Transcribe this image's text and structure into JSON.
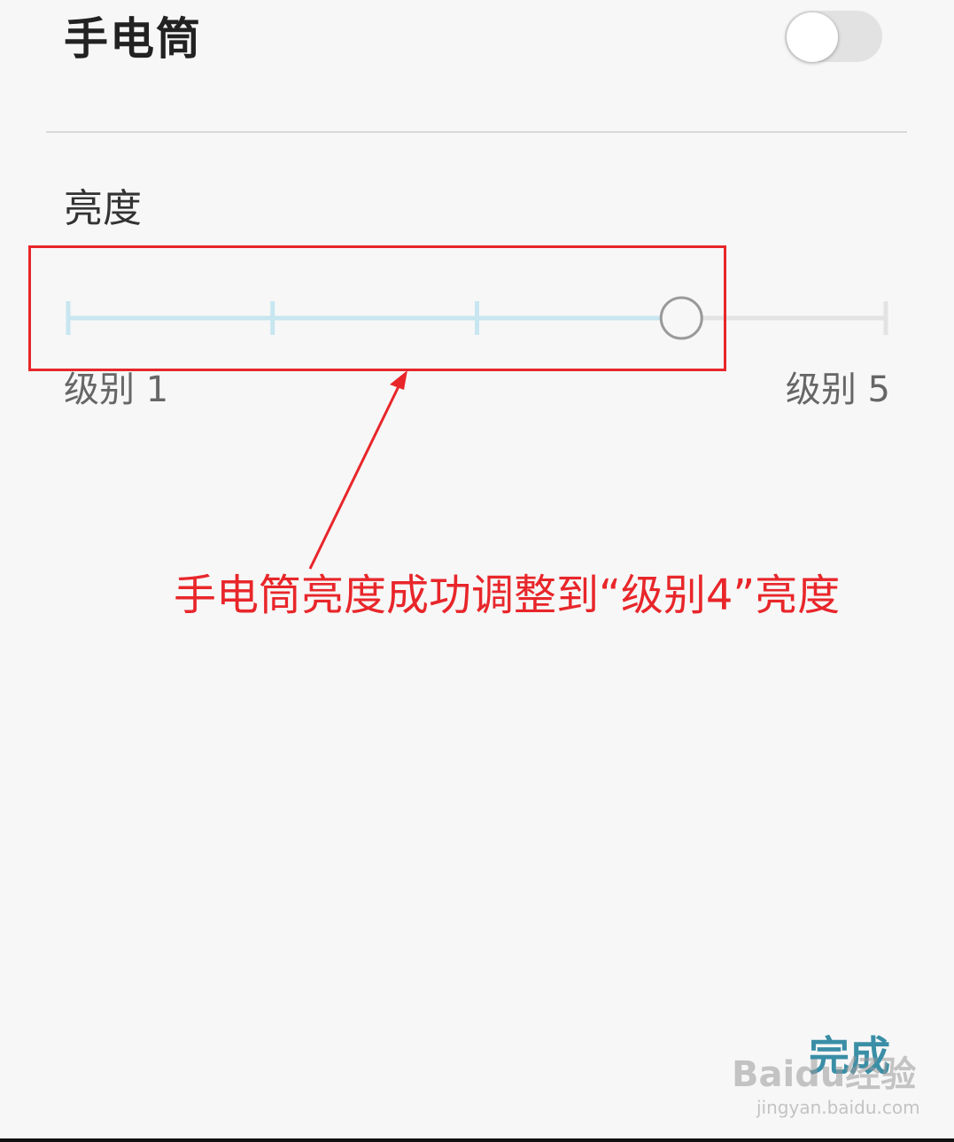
{
  "header": {
    "title": "手电筒"
  },
  "flashlight_toggle": {
    "on": false,
    "color_off": "#e2e2e2"
  },
  "brightness": {
    "label": "亮度",
    "min_label": "级别 1",
    "max_label": "级别 5",
    "min_level": 1,
    "max_level": 5,
    "current_level": 4,
    "active_color": "#c7e6f0",
    "inactive_color": "#e3e3e3",
    "thumb_color": "#9a9a9a"
  },
  "annotation": {
    "text": "手电筒亮度成功调整到“级别4”亮度",
    "color": "#e8262a"
  },
  "footer": {
    "done_label": "完成"
  },
  "watermark": {
    "brand": "Baidu经验",
    "url": "jingyan.baidu.com"
  }
}
